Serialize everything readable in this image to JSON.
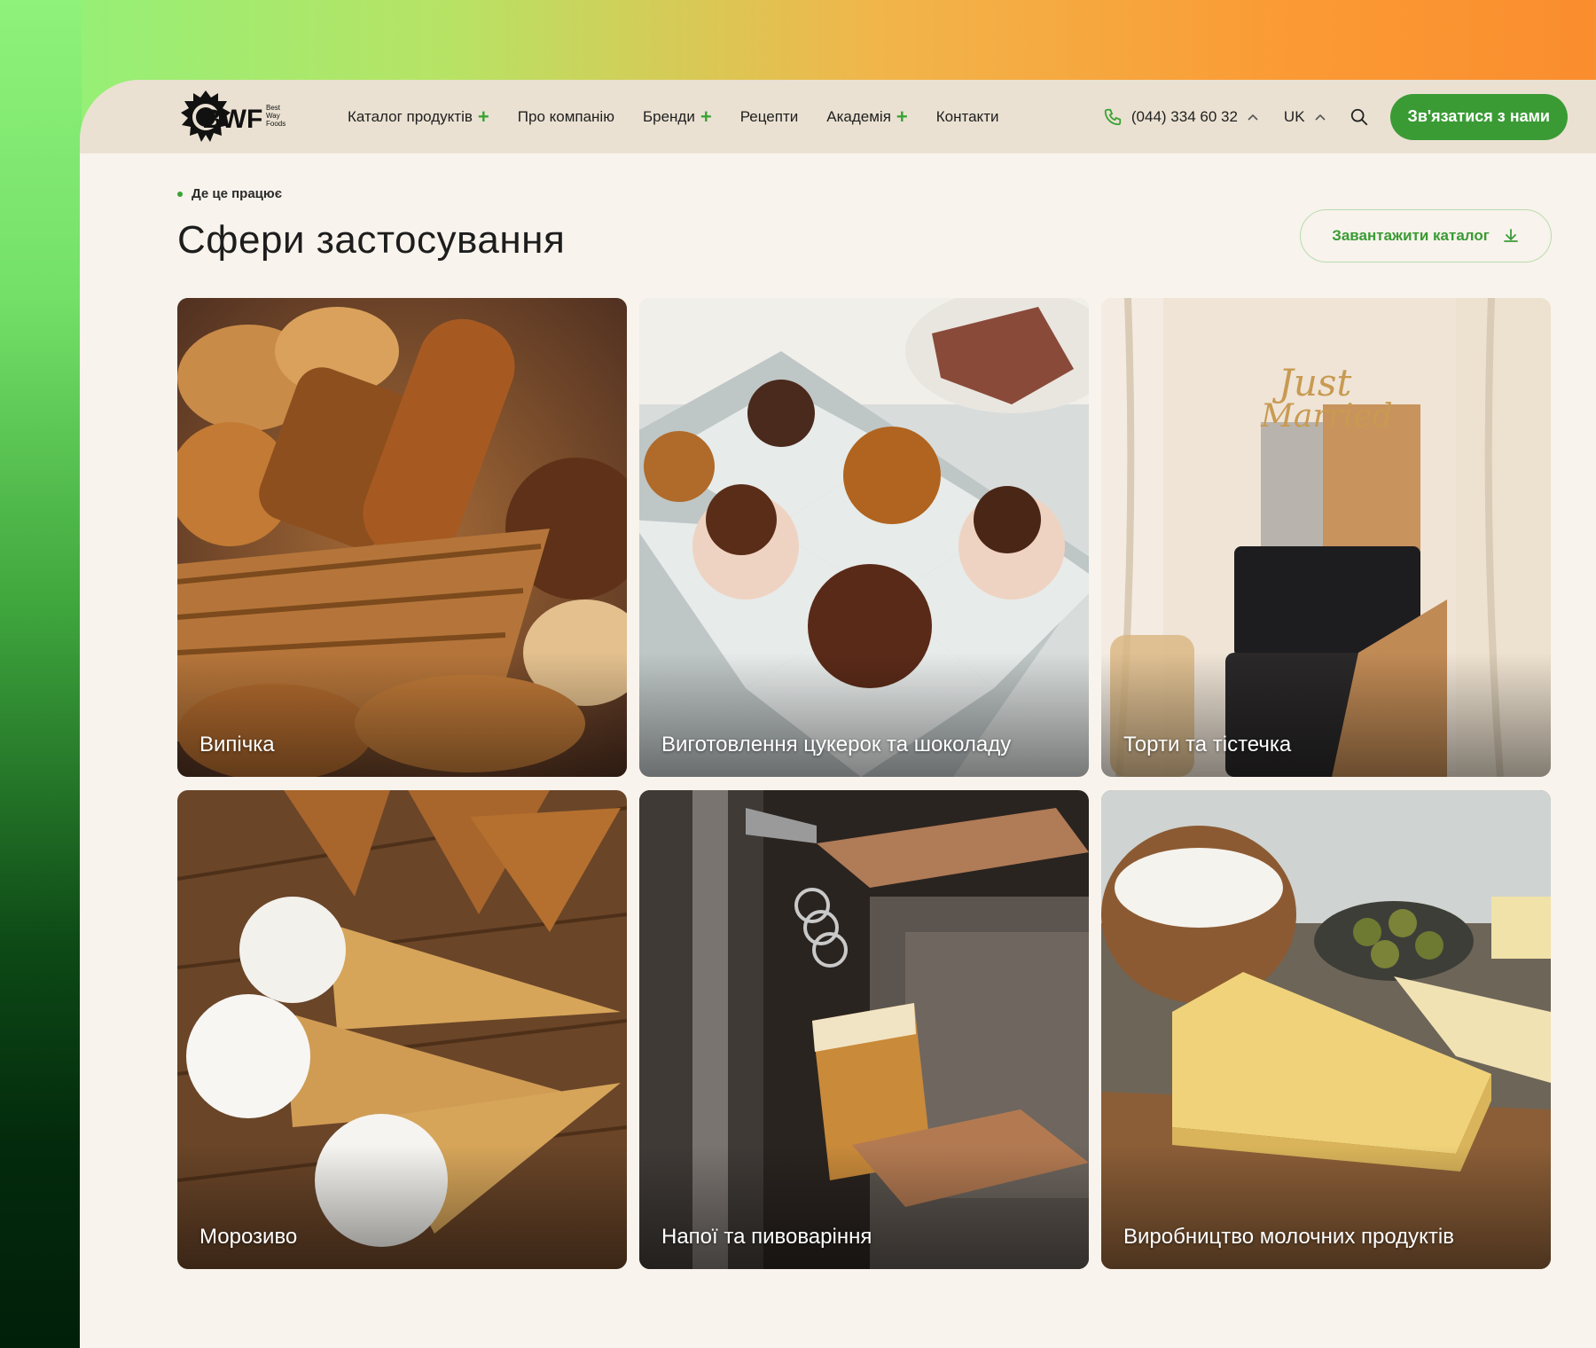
{
  "header": {
    "logo": {
      "main": "BWF",
      "sub": [
        "Best",
        "Way",
        "Foods"
      ]
    },
    "nav": [
      {
        "label": "Каталог продуктів",
        "has_plus": true
      },
      {
        "label": "Про компанію",
        "has_plus": false
      },
      {
        "label": "Бренди",
        "has_plus": true
      },
      {
        "label": "Рецепти",
        "has_plus": false
      },
      {
        "label": "Академія",
        "has_plus": true
      },
      {
        "label": "Контакти",
        "has_plus": false
      }
    ],
    "phone": "(044) 334 60 32",
    "language": "UK",
    "contact_button": "Зв'язатися з нами"
  },
  "section": {
    "eyebrow": "Де це працює",
    "title": "Сфери застосування",
    "download_button": "Завантажити каталог"
  },
  "cards": [
    {
      "label": "Випічка",
      "icon": "bread-image"
    },
    {
      "label": "Виготовлення цукерок та шоколаду",
      "icon": "candy-image"
    },
    {
      "label": "Торти та тістечка",
      "icon": "cake-image"
    },
    {
      "label": "Морозиво",
      "icon": "ice-cream-image"
    },
    {
      "label": "Напої та пивоваріння",
      "icon": "beer-image"
    },
    {
      "label": "Виробництво молочних продуктів",
      "icon": "cheese-image"
    }
  ],
  "colors": {
    "accent": "#3a9b35",
    "header_bg": "#eae1d2",
    "page_bg": "#f8f3ec"
  }
}
